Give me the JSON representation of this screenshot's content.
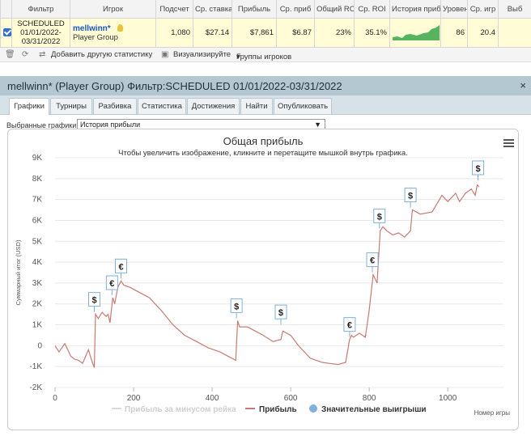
{
  "stats_table": {
    "headers": [
      "",
      "Фильтр",
      "Игрок",
      "Подсчет",
      "Ср. ставка",
      "Прибыль",
      "Ср. приб",
      "Общий ROI",
      "Ср. ROI",
      "История приб",
      "Уровень",
      "Ср. игр",
      "Выб"
    ],
    "row": {
      "filter_lines": [
        "SCHEDULED",
        "01/01/2022-",
        "03/31/2022"
      ],
      "player_name": "mellwinn*",
      "player_group": "Player Group",
      "count": "1,080",
      "avg_stake": "$27.14",
      "profit": "$7,861",
      "avg_profit": "$6.87",
      "total_roi": "23%",
      "avg_roi": "35.1%",
      "level": "86",
      "avg_games": "20.4"
    }
  },
  "toolbar": {
    "delete_icon": "trash-icon",
    "refresh_icon": "refresh-icon",
    "add_stat": "Добавить другую статистику",
    "visualize": "Визуализируйте",
    "groups": "Группы игроков"
  },
  "panel": {
    "title": "mellwinn* (Player Group) Фильтр:SCHEDULED 01/01/2022-03/31/2022",
    "close": "×",
    "tabs": [
      "Графики",
      "Турниры",
      "Разбивка",
      "Статистика",
      "Достижения",
      "Найти",
      "Опубликовать"
    ],
    "select_label": "Выбранные графики:",
    "select_value": "История прибыли"
  },
  "chart_data": {
    "type": "line",
    "title": "Общая прибыль",
    "subtitle": "Чтобы увеличить изображение, кликните и перетащите мышкой внутрь графика.",
    "ylabel": "Суммарный итог (USD)",
    "xlabel": "Номер игры",
    "ylim": [
      -2000,
      9000
    ],
    "xlim": [
      0,
      1080
    ],
    "y_ticks": [
      "-2K",
      "-1K",
      "0",
      "1K",
      "2K",
      "3K",
      "4K",
      "5K",
      "6K",
      "7K",
      "8K",
      "9K"
    ],
    "x_ticks": [
      "0",
      "200",
      "400",
      "600",
      "800",
      "1000"
    ],
    "legend": [
      "Прибыль за минусом рейка",
      "Прибыль",
      "Значительные выигрыши"
    ],
    "series": [
      {
        "name": "Прибыль",
        "x": [
          0,
          10,
          25,
          40,
          50,
          60,
          70,
          85,
          95,
          100,
          103,
          110,
          120,
          130,
          135,
          140,
          147,
          152,
          160,
          168,
          175,
          190,
          210,
          240,
          270,
          300,
          330,
          360,
          390,
          420,
          440,
          460,
          465,
          470,
          490,
          510,
          530,
          555,
          575,
          580,
          600,
          620,
          650,
          680,
          700,
          720,
          740,
          750,
          755,
          760,
          775,
          790,
          800,
          810,
          820,
          828,
          835,
          845,
          860,
          875,
          890,
          905,
          910,
          930,
          960,
          985,
          1000,
          1020,
          1030,
          1045,
          1060,
          1070,
          1075,
          1080
        ],
        "values": [
          0,
          -300,
          100,
          -500,
          -650,
          -700,
          -850,
          -200,
          -800,
          -1050,
          1500,
          1300,
          1600,
          1400,
          1500,
          1100,
          2300,
          2000,
          2800,
          3100,
          2900,
          2800,
          2600,
          2300,
          1700,
          1000,
          500,
          200,
          -100,
          -300,
          -500,
          -700,
          1200,
          900,
          900,
          700,
          500,
          200,
          300,
          700,
          500,
          0,
          -600,
          -800,
          -850,
          -900,
          -800,
          300,
          500,
          400,
          600,
          400,
          1700,
          3400,
          3000,
          5500,
          5700,
          5500,
          5300,
          5400,
          5200,
          5500,
          6500,
          6300,
          6400,
          7200,
          6900,
          7300,
          6900,
          7300,
          7500,
          7200,
          7700,
          7600
        ]
      }
    ],
    "big_wins": [
      {
        "x": 100,
        "y": 1500,
        "symbol": "$"
      },
      {
        "x": 145,
        "y": 2300,
        "symbol": "€"
      },
      {
        "x": 168,
        "y": 3100,
        "symbol": "€"
      },
      {
        "x": 462,
        "y": 1200,
        "symbol": "$"
      },
      {
        "x": 575,
        "y": 900,
        "symbol": "$"
      },
      {
        "x": 750,
        "y": 300,
        "symbol": "€"
      },
      {
        "x": 808,
        "y": 3400,
        "symbol": "€"
      },
      {
        "x": 826,
        "y": 5500,
        "symbol": "$"
      },
      {
        "x": 905,
        "y": 6500,
        "symbol": "$"
      },
      {
        "x": 1077,
        "y": 7800,
        "symbol": "$"
      }
    ],
    "colors": {
      "profit": "#c87a74",
      "rake": "#d9d9d9",
      "big_win": "#7fb0de"
    }
  }
}
